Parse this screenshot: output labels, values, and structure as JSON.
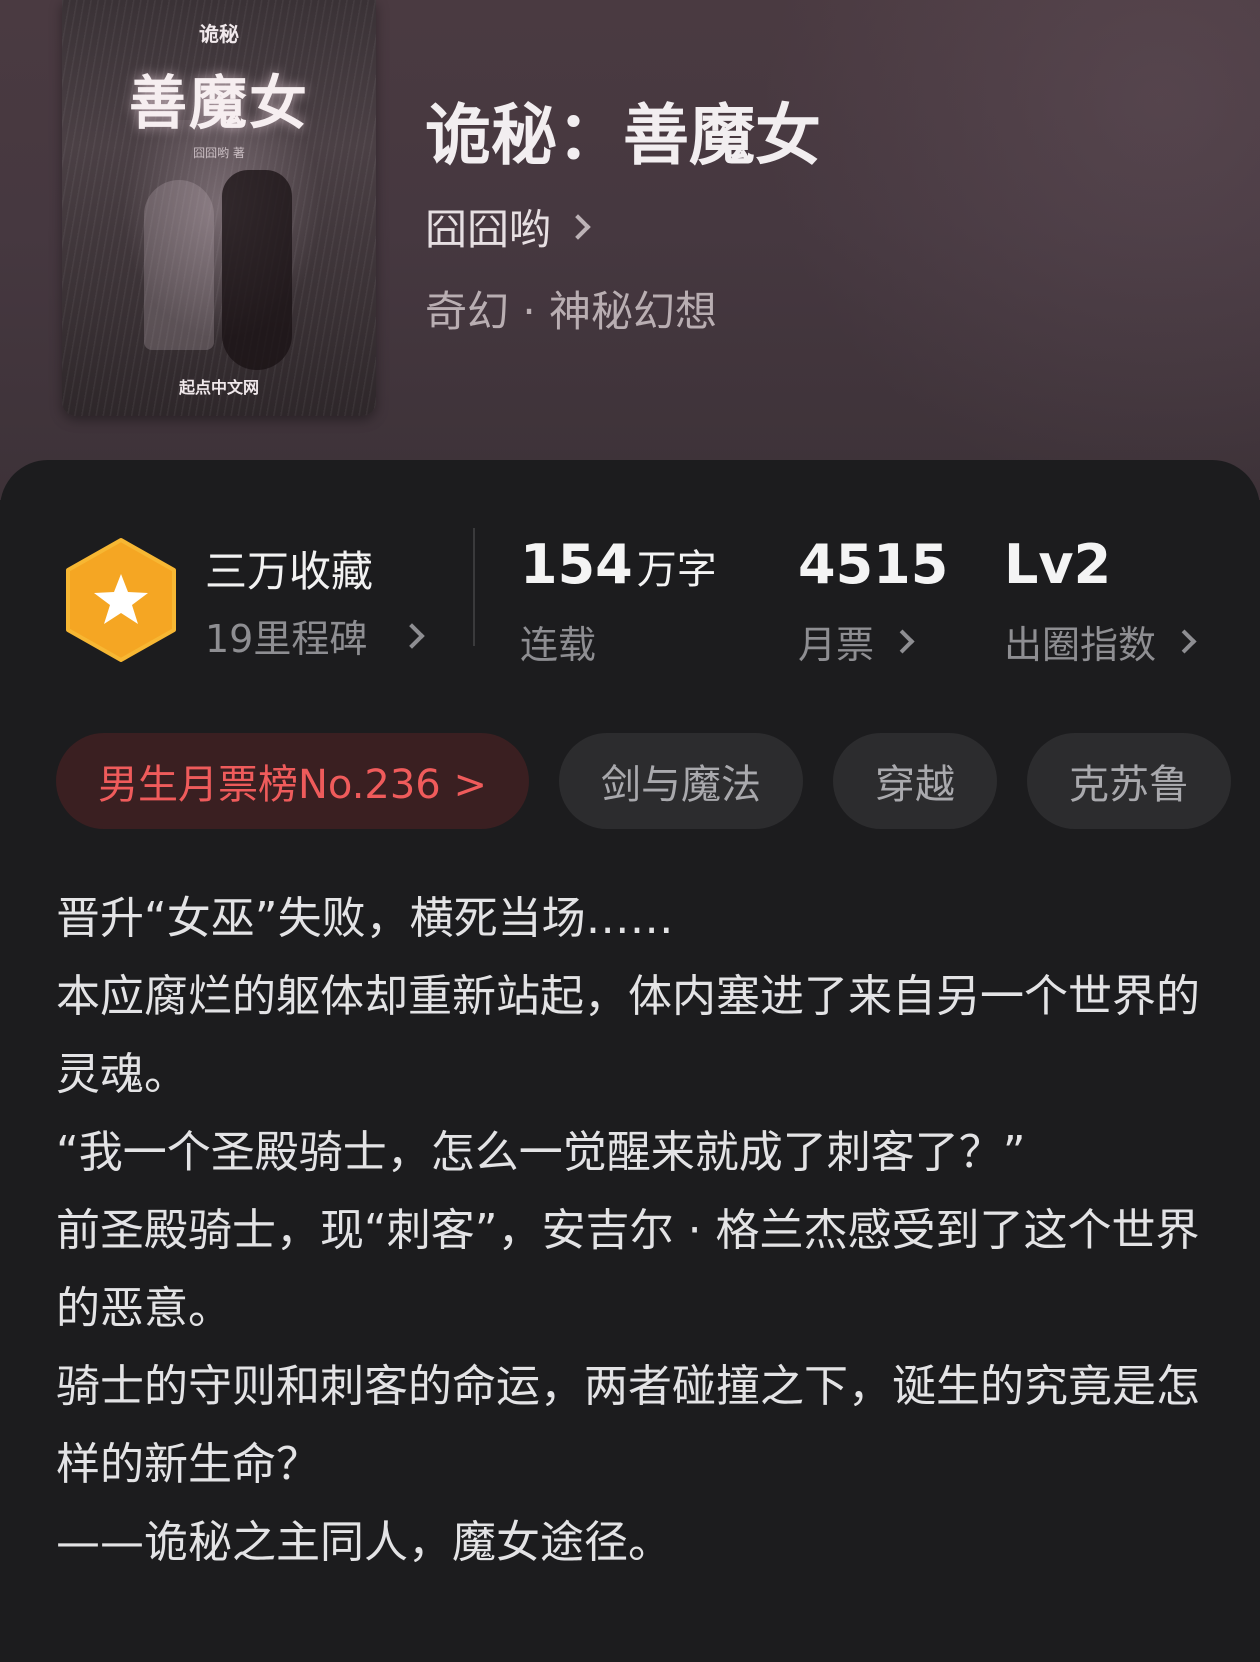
{
  "book": {
    "cover": {
      "series": "诡秘",
      "title": "善魔女",
      "author_small": "囧囧哟 著",
      "publisher": "起点中文网"
    },
    "title": "诡秘：善魔女",
    "author": "囧囧哟",
    "genre": "奇幻 · 神秘幻想"
  },
  "stats": {
    "favorites": {
      "label": "三万收藏",
      "milestone": "19里程碑",
      "icon": "star-badge-icon",
      "badge_color": "#f5a623"
    },
    "words": {
      "value": "154",
      "unit": "万字",
      "label": "连载"
    },
    "monthly_votes": {
      "value": "4515",
      "label": "月票"
    },
    "breakout_index": {
      "value": "Lv2",
      "label": "出圈指数"
    }
  },
  "tags": [
    {
      "label": "男生月票榜No.236 >",
      "color": "#ef5b5b"
    },
    {
      "label": "剑与魔法"
    },
    {
      "label": "穿越"
    },
    {
      "label": "克苏鲁"
    }
  ],
  "synopsis": [
    "晋升“女巫”失败，横死当场……",
    "本应腐烂的躯体却重新站起，体内塞进了来自另一个世界的灵魂。",
    "“我一个圣殿骑士，怎么一觉醒来就成了刺客了？”",
    "前圣殿骑士，现“刺客”，安吉尔 · 格兰杰感受到了这个世界的恶意。",
    "骑士的守则和刺客的命运，两者碰撞之下，诞生的究竟是怎样的新生命？",
    "——诡秘之主同人，魔女途径。"
  ]
}
